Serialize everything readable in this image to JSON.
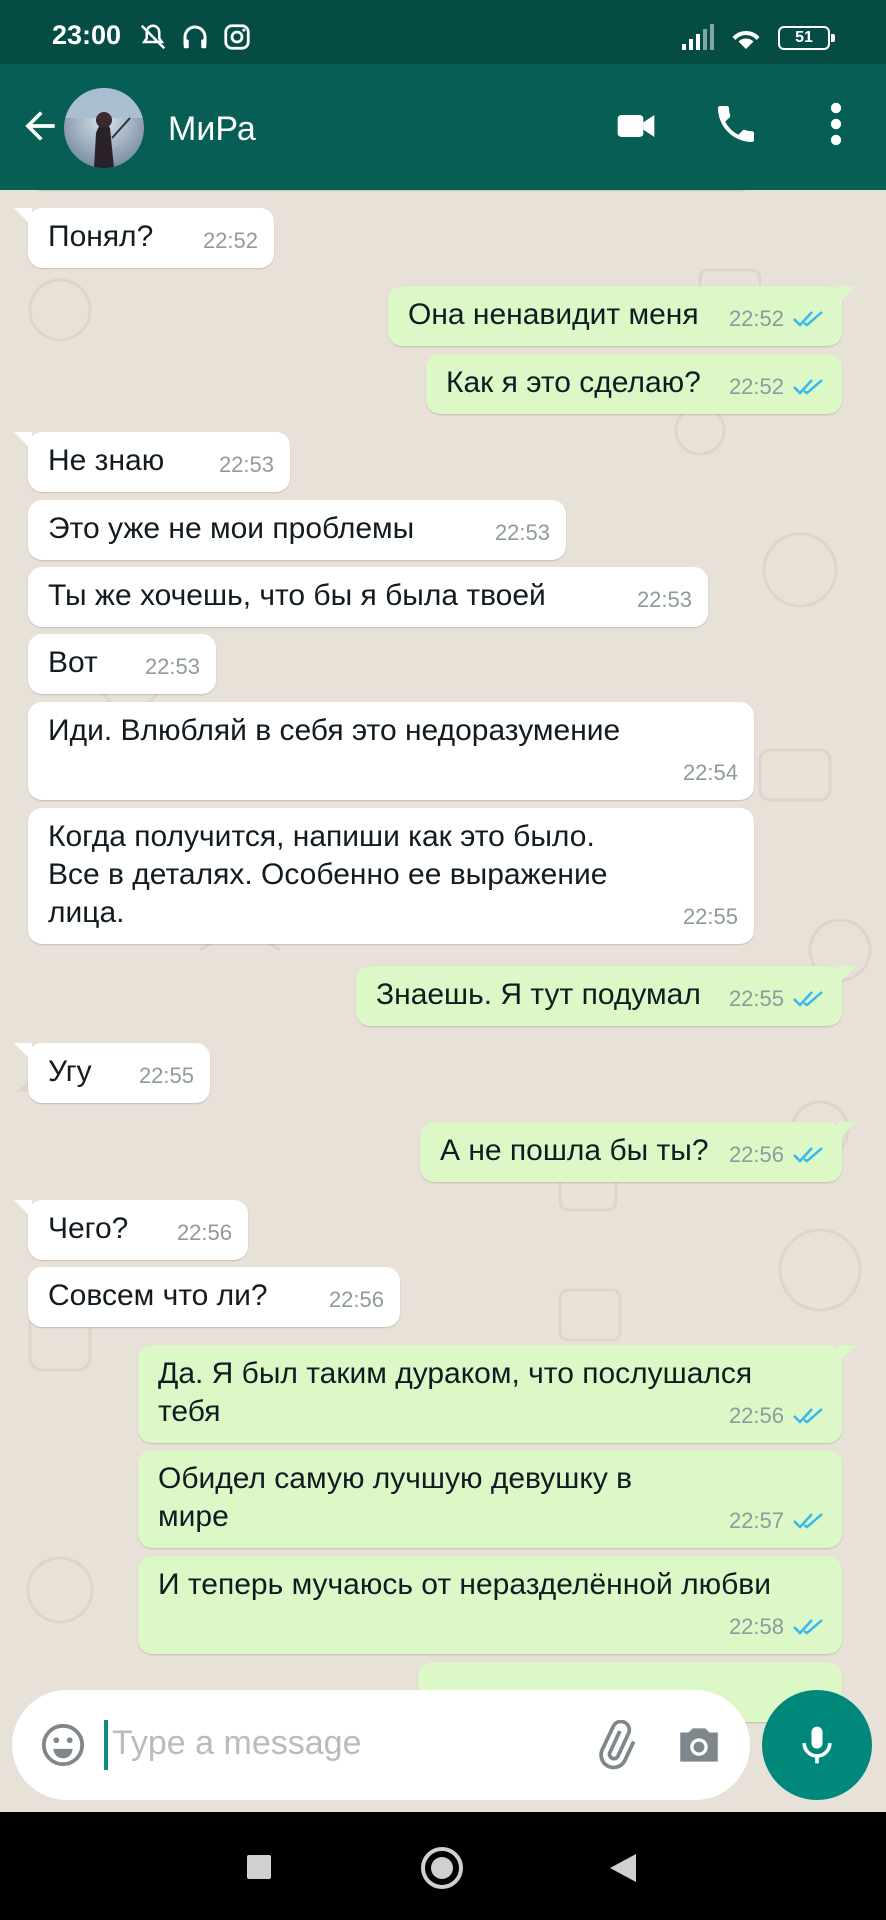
{
  "status_bar": {
    "time": "23:00",
    "battery": "51",
    "icons": [
      "mute-icon",
      "headphones-icon",
      "instagram-icon",
      "signal-icon",
      "wifi-icon",
      "battery-icon"
    ]
  },
  "header": {
    "contact_name": "МиРа",
    "icons": [
      "back-arrow-icon",
      "video-call-icon",
      "phone-icon",
      "more-options-icon"
    ]
  },
  "messages": [
    {
      "dir": "in",
      "text": "Понял?",
      "time": "22:52"
    },
    {
      "dir": "out",
      "text": "Она ненавидит меня",
      "time": "22:52",
      "read": true
    },
    {
      "dir": "out",
      "text": "Как я это сделаю?",
      "time": "22:52",
      "read": true
    },
    {
      "dir": "in",
      "text": "Не знаю",
      "time": "22:53"
    },
    {
      "dir": "in",
      "text": "Это уже не мои проблемы",
      "time": "22:53"
    },
    {
      "dir": "in",
      "text": "Ты же хочешь, что бы я была твоей",
      "time": "22:53"
    },
    {
      "dir": "in",
      "text": "Вот",
      "time": "22:53"
    },
    {
      "dir": "in",
      "text": "Иди. Влюбляй в себя это недоразумение",
      "time": "22:54"
    },
    {
      "dir": "in",
      "text": "Когда получится, напиши как это было. Все в деталях. Особенно ее выражение лица.",
      "time": "22:55"
    },
    {
      "dir": "out",
      "text": "Знаешь. Я тут подумал",
      "time": "22:55",
      "read": true
    },
    {
      "dir": "in",
      "text": "Угу",
      "time": "22:55"
    },
    {
      "dir": "out",
      "text": "А не пошла бы ты?",
      "time": "22:56",
      "read": true
    },
    {
      "dir": "in",
      "text": "Чего?",
      "time": "22:56"
    },
    {
      "dir": "in",
      "text": "Совсем что ли?",
      "time": "22:56"
    },
    {
      "dir": "out",
      "text": "Да. Я был таким дураком, что послушался тебя",
      "time": "22:56",
      "read": true
    },
    {
      "dir": "out",
      "text": "Обидел самую лучшую девушку в мире",
      "time": "22:57",
      "read": true
    },
    {
      "dir": "out",
      "text": "И теперь мучаюсь от неразделённой любви",
      "time": "22:58",
      "read": true
    }
  ],
  "composer": {
    "placeholder": "Type a message",
    "icons": [
      "emoji-icon",
      "attach-icon",
      "camera-icon",
      "mic-icon"
    ]
  },
  "colors": {
    "header": "#075e54",
    "status_bar": "#054d44",
    "outgoing_bubble": "#dcf8c6",
    "incoming_bubble": "#ffffff",
    "read_ticks": "#34b7f1",
    "mic_button": "#00897b"
  },
  "navigation": {
    "icons": [
      "recents-square-icon",
      "home-circle-icon",
      "back-triangle-icon"
    ]
  }
}
